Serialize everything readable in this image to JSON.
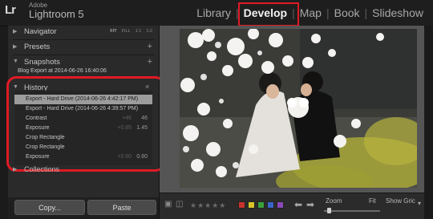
{
  "app": {
    "brand_small": "Adobe",
    "brand_name": "Lightroom 5",
    "logo": "Lr"
  },
  "modules": [
    {
      "label": "Library",
      "active": false
    },
    {
      "label": "Develop",
      "active": true
    },
    {
      "label": "Map",
      "active": false
    },
    {
      "label": "Book",
      "active": false
    },
    {
      "label": "Slideshow",
      "active": false
    }
  ],
  "left_panel": {
    "navigator": {
      "label": "Navigator",
      "options": [
        "FIT",
        "FILL",
        "1:1",
        "1:2"
      ]
    },
    "presets": {
      "label": "Presets"
    },
    "snapshots": {
      "label": "Snapshots",
      "item": "Blog Export at 2014-06-26 16:40:06"
    },
    "history": {
      "label": "History",
      "items": [
        {
          "name": "Export - Hard Drive (2014-06-26 4:42:17 PM)",
          "v1": "",
          "v2": "",
          "selected": true
        },
        {
          "name": "Export - Hard Drive (2014-06-26 4:39:57 PM)",
          "v1": "",
          "v2": "",
          "selected": false
        },
        {
          "name": "Contrast",
          "v1": "+46",
          "v2": "46",
          "selected": false
        },
        {
          "name": "Exposure",
          "v1": "+0.85",
          "v2": "1.45",
          "selected": false
        },
        {
          "name": "Crop Rectangle",
          "v1": "",
          "v2": "",
          "selected": false
        },
        {
          "name": "Crop Rectangle",
          "v1": "",
          "v2": "",
          "selected": false
        },
        {
          "name": "Exposure",
          "v1": "+0.60",
          "v2": "0.60",
          "selected": false
        }
      ]
    },
    "collections": {
      "label": "Collections"
    },
    "copy_label": "Copy...",
    "paste_label": "Paste"
  },
  "toolbar": {
    "stars": "★★★★★",
    "swatch_colors": [
      "#c8322c",
      "#d9c52a",
      "#3aa13c",
      "#3a64c8",
      "#8a48b8"
    ],
    "prev_arrow": "⬅",
    "next_arrow": "➡",
    "zoom_label": "Zoom",
    "fit_label": "Fit",
    "show_grid_label": "Show Gric"
  },
  "colors": {
    "highlight": "#e01a24"
  }
}
